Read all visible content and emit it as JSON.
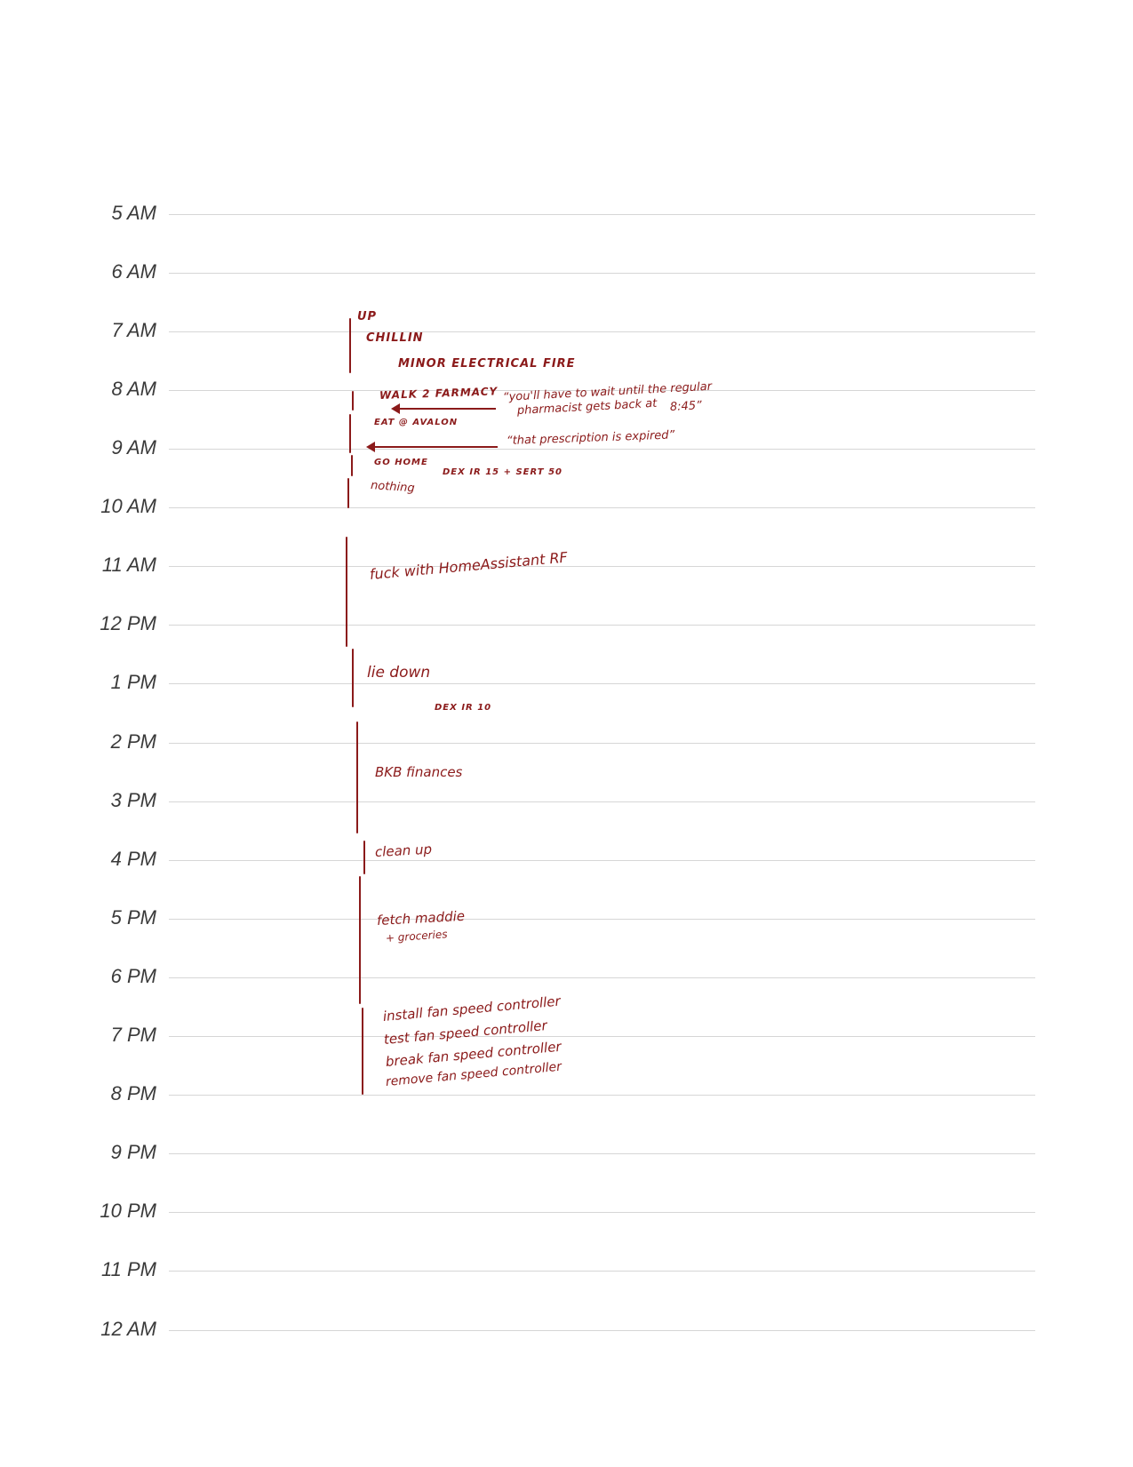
{
  "hours": [
    "5 AM",
    "6 AM",
    "7 AM",
    "8 AM",
    "9 AM",
    "10 AM",
    "11 AM",
    "12 PM",
    "1 PM",
    "2 PM",
    "3 PM",
    "4 PM",
    "5 PM",
    "6 PM",
    "7 PM",
    "8 PM",
    "9 PM",
    "10 PM",
    "11 PM",
    "12 AM"
  ],
  "notes": {
    "up": "UP",
    "chillin": "CHILLIN",
    "minor_fire": "MINOR ELECTRICAL FIRE",
    "walk_farmacy": "WALK 2 FARMACY",
    "wait_quote_line1": "“you'll have to wait until the regular",
    "wait_quote_line2": "pharmacist gets back at",
    "wait_quote_time": "8:45”",
    "eat_avalon": "EAT @ AVALON",
    "expired_quote": "“that prescription is expired”",
    "go_home": "GO HOME",
    "dex_morning": "DEX IR 15 + SERT 50",
    "nothing": "nothing",
    "homeassistant": "fuck with HomeAssistant RF",
    "lie_down": "lie down",
    "dex_afternoon": "DEX IR 10",
    "bkb": "BKB finances",
    "clean_up": "clean up",
    "fetch_line1": "fetch maddie",
    "fetch_line2": "+ groceries",
    "fan1": "install fan speed controller",
    "fan2": "test fan speed controller",
    "fan3": "break fan speed controller",
    "fan4": "remove fan speed controller"
  },
  "colors": {
    "ink": "#8b1a1a",
    "rule": "#d6d6d6",
    "label": "#3a3a3a"
  }
}
